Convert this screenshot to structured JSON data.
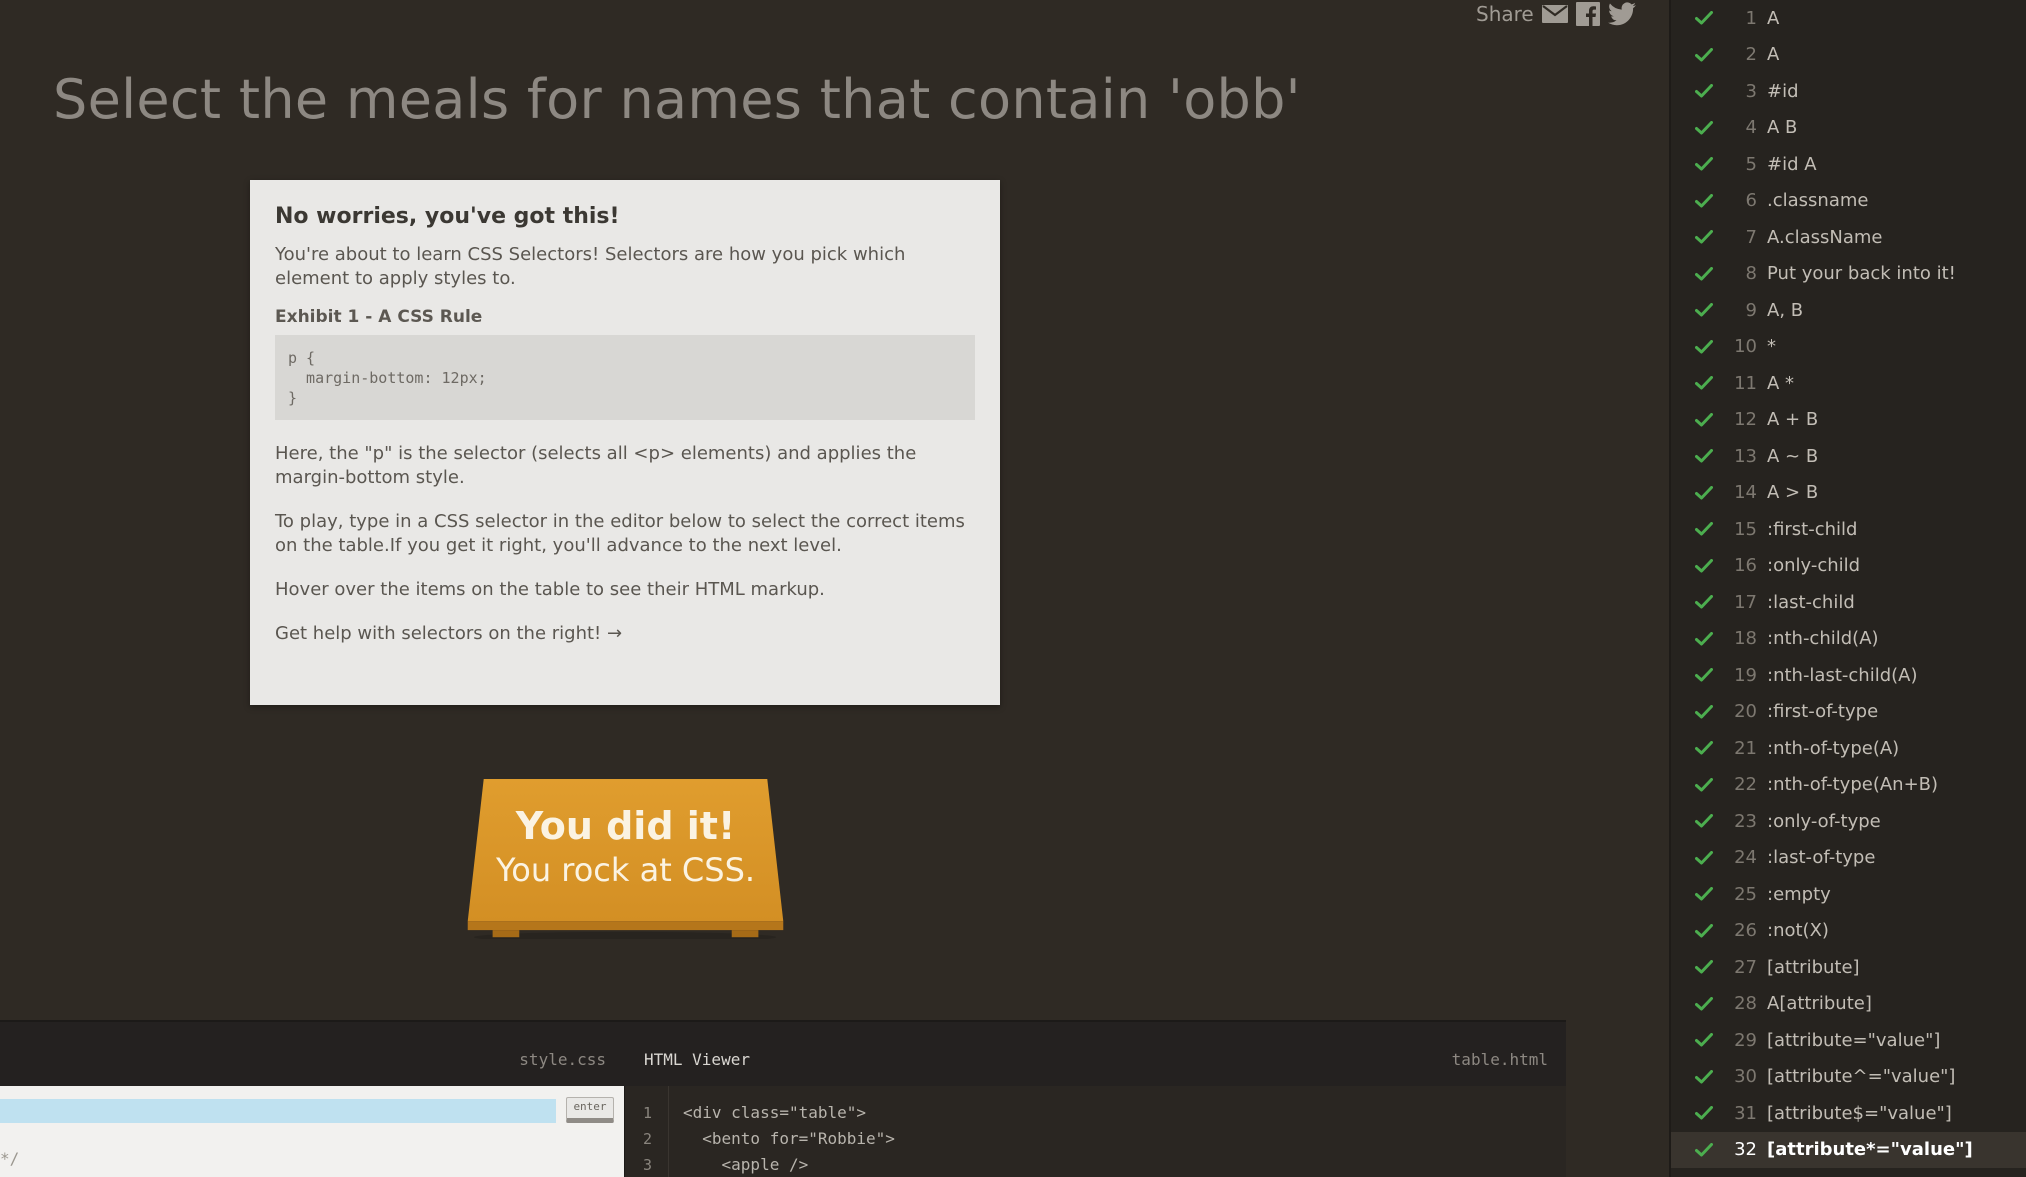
{
  "header": {
    "share_label": "Share",
    "share_icons": [
      "mail-icon",
      "facebook-icon",
      "twitter-icon"
    ],
    "level_title": "Select the meals for names that contain 'obb'"
  },
  "help": {
    "title": "No worries, you've got this!",
    "intro": "You're about to learn CSS Selectors! Selectors are how you pick which element to apply styles to.",
    "exhibit_label": "Exhibit 1 - A CSS Rule",
    "code": "p {\n  margin-bottom: 12px;\n}",
    "p1": "Here, the \"p\" is the selector (selects all <p> elements) and applies the margin-bottom style.",
    "p2": "To play, type in a CSS selector in the editor below to select the correct items on the table.If you get it right, you'll advance to the next level.",
    "p3": "Hover over the items on the table to see their HTML markup.",
    "p4": "Get help with selectors on the right! →"
  },
  "victory": {
    "line1": "You did it!",
    "line2": "You rock at CSS.",
    "color": "#d9952a"
  },
  "editor": {
    "css_filename": "style.css",
    "input_value": "",
    "enter_label": "enter",
    "css_comment": "*/",
    "html_title": "HTML Viewer",
    "html_filename": "table.html",
    "line_numbers": [
      "1",
      "2",
      "3"
    ],
    "code_lines": [
      "<div class=\"table\">",
      "  <bento for=\"Robbie\">",
      "    <apple />"
    ]
  },
  "levels": {
    "check_color": "#4cae4f",
    "current": 32,
    "items": [
      {
        "num": "1",
        "name": "A"
      },
      {
        "num": "2",
        "name": "A"
      },
      {
        "num": "3",
        "name": "#id"
      },
      {
        "num": "4",
        "name": "A  B"
      },
      {
        "num": "5",
        "name": "#id  A"
      },
      {
        "num": "6",
        "name": ".classname"
      },
      {
        "num": "7",
        "name": "A.className"
      },
      {
        "num": "8",
        "name": "Put your back into it!"
      },
      {
        "num": "9",
        "name": "A, B"
      },
      {
        "num": "10",
        "name": "*"
      },
      {
        "num": "11",
        "name": "A  *"
      },
      {
        "num": "12",
        "name": "A + B"
      },
      {
        "num": "13",
        "name": "A ~ B"
      },
      {
        "num": "14",
        "name": "A > B"
      },
      {
        "num": "15",
        "name": ":first-child"
      },
      {
        "num": "16",
        "name": ":only-child"
      },
      {
        "num": "17",
        "name": ":last-child"
      },
      {
        "num": "18",
        "name": ":nth-child(A)"
      },
      {
        "num": "19",
        "name": ":nth-last-child(A)"
      },
      {
        "num": "20",
        "name": ":first-of-type"
      },
      {
        "num": "21",
        "name": ":nth-of-type(A)"
      },
      {
        "num": "22",
        "name": ":nth-of-type(An+B)"
      },
      {
        "num": "23",
        "name": ":only-of-type"
      },
      {
        "num": "24",
        "name": ":last-of-type"
      },
      {
        "num": "25",
        "name": ":empty"
      },
      {
        "num": "26",
        "name": ":not(X)"
      },
      {
        "num": "27",
        "name": "[attribute]"
      },
      {
        "num": "28",
        "name": "A[attribute]"
      },
      {
        "num": "29",
        "name": "[attribute=\"value\"]"
      },
      {
        "num": "30",
        "name": "[attribute^=\"value\"]"
      },
      {
        "num": "31",
        "name": "[attribute$=\"value\"]"
      },
      {
        "num": "32",
        "name": "[attribute*=\"value\"]"
      }
    ]
  }
}
